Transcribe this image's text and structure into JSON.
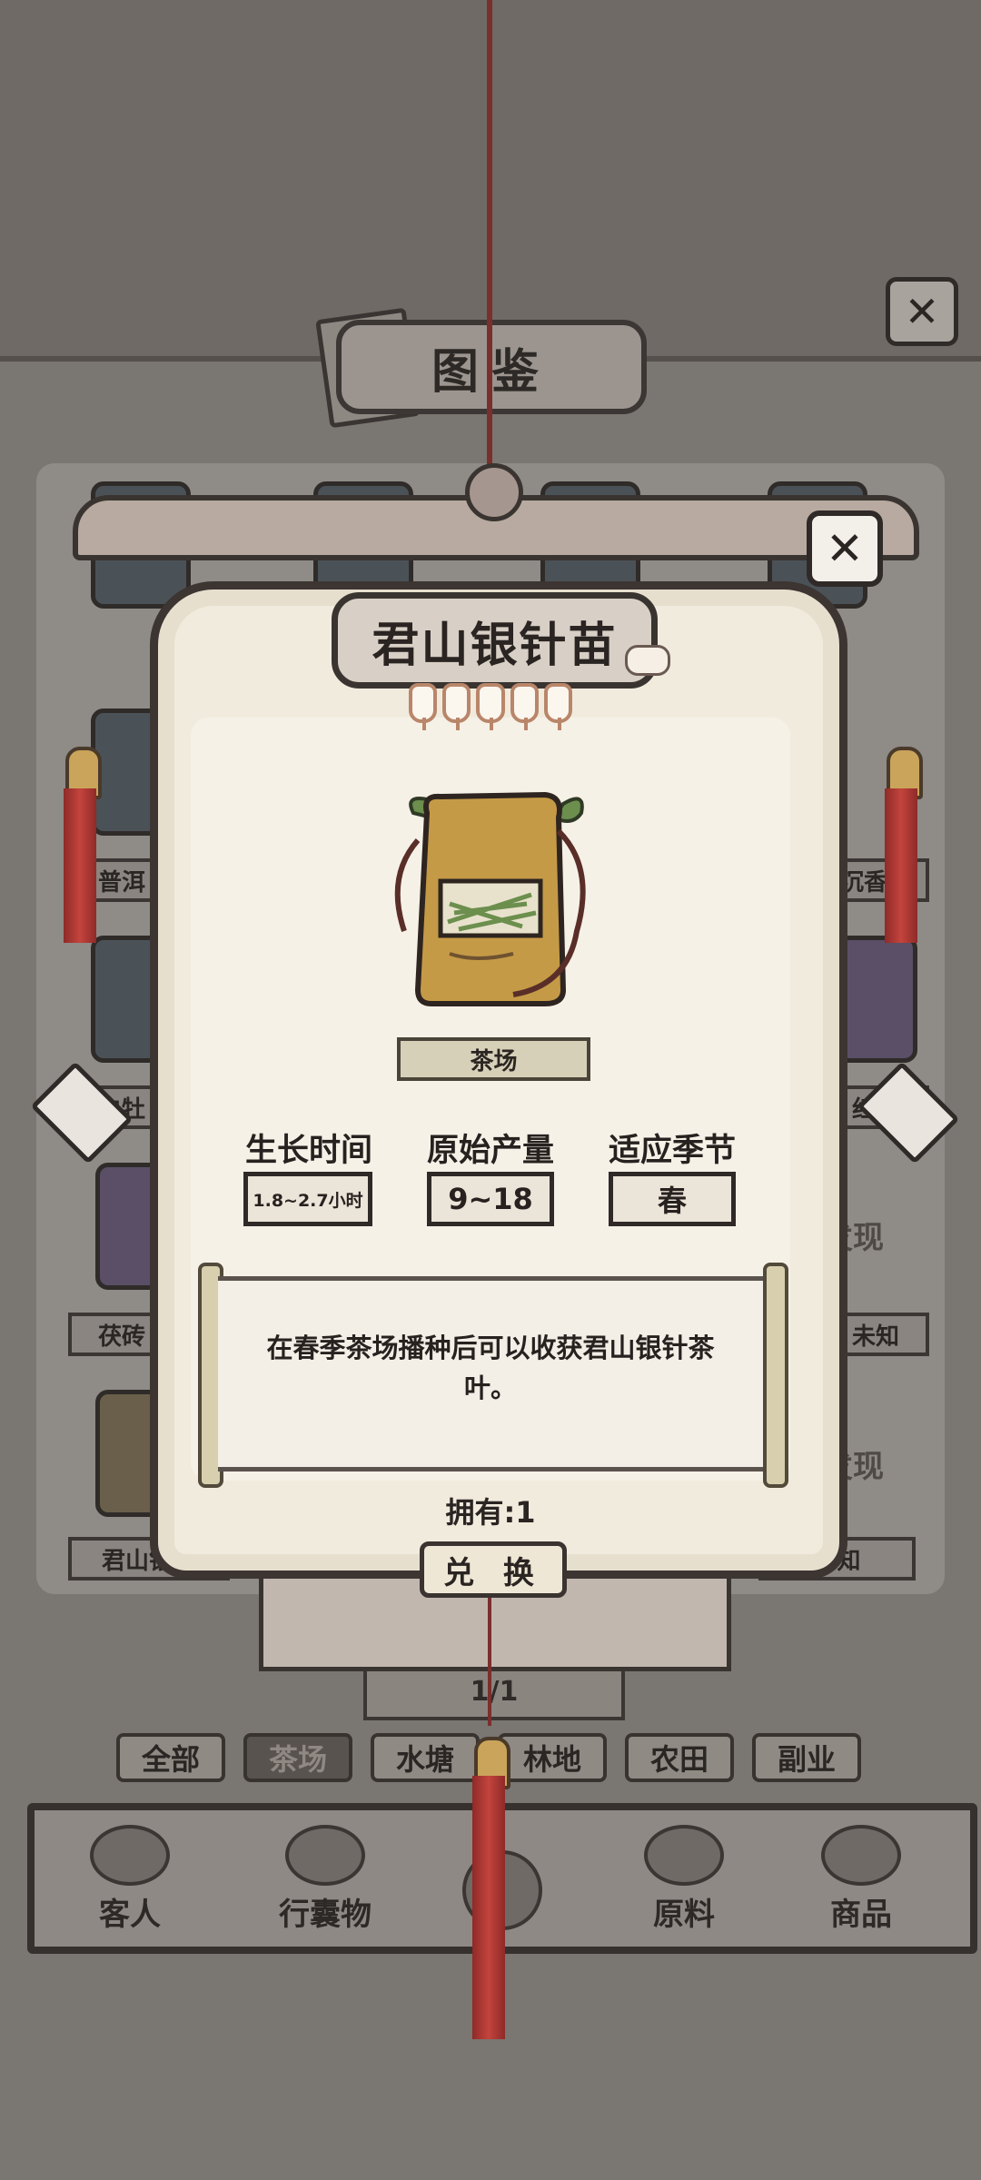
{
  "codex": {
    "title": "图鉴",
    "grid_labels_left": [
      "普洱",
      "白牡",
      "茯砖",
      "君山银针"
    ],
    "grid_labels_right": [
      "沉香苗",
      "红茶",
      "未知",
      "未知"
    ],
    "undiscovered": "发现",
    "pager": "1/1",
    "filters": [
      "全部",
      "茶场",
      "水塘",
      "林地",
      "农田",
      "副业"
    ],
    "active_filter": "茶场"
  },
  "bottom_nav": [
    "客人",
    "行囊物",
    "",
    "原料",
    "商品"
  ],
  "modal": {
    "title": "君山银针苗",
    "rarity_lanterns": 5,
    "source": "茶场",
    "stats": [
      {
        "label": "生长时间",
        "value": "1.8~2.7小时"
      },
      {
        "label": "原始产量",
        "value": "9~18"
      },
      {
        "label": "适应季节",
        "value": "春"
      }
    ],
    "description": "在春季茶场播种后可以收获君山银针茶叶。",
    "owned": "拥有:1",
    "redeem": "兑 换",
    "close_glyph": "✕"
  },
  "colors": {
    "paper": "#f1ebde",
    "ink": "#2b2522",
    "tassel_red": "#c4443d",
    "leaf_green": "#6c8f4e",
    "pouch_ochre": "#c59a47"
  }
}
